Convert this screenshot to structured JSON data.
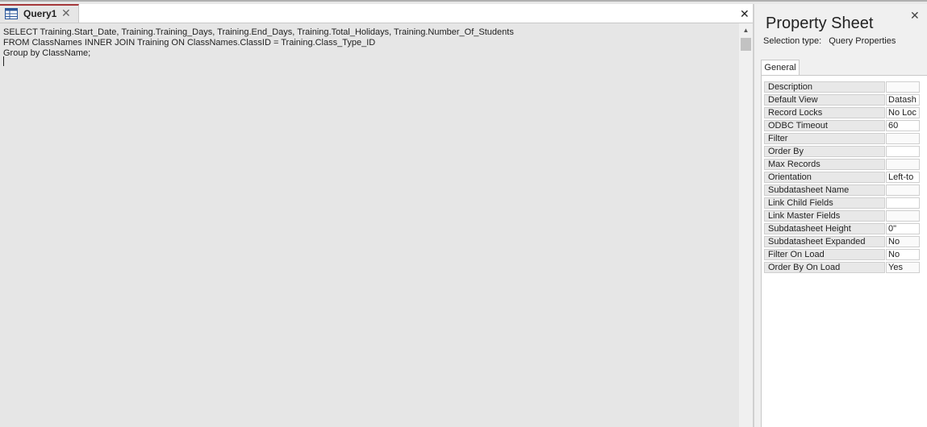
{
  "document": {
    "tab_label": "Query1",
    "sql_lines": [
      "SELECT Training.Start_Date, Training.Training_Days, Training.End_Days, Training.Total_Holidays, Training.Number_Of_Students",
      "FROM ClassNames INNER JOIN Training ON ClassNames.ClassID = Training.Class_Type_ID",
      "Group by ClassName;"
    ]
  },
  "property_sheet": {
    "title": "Property Sheet",
    "selection_type_label": "Selection type:",
    "selection_type_value": "Query Properties",
    "active_tab": "General",
    "properties": [
      {
        "name": "Description",
        "value": ""
      },
      {
        "name": "Default View",
        "value": "Datash"
      },
      {
        "name": "Record Locks",
        "value": "No Loc"
      },
      {
        "name": "ODBC Timeout",
        "value": "60"
      },
      {
        "name": "Filter",
        "value": ""
      },
      {
        "name": "Order By",
        "value": ""
      },
      {
        "name": "Max Records",
        "value": ""
      },
      {
        "name": "Orientation",
        "value": "Left-to"
      },
      {
        "name": "Subdatasheet Name",
        "value": ""
      },
      {
        "name": "Link Child Fields",
        "value": ""
      },
      {
        "name": "Link Master Fields",
        "value": ""
      },
      {
        "name": "Subdatasheet Height",
        "value": "0\""
      },
      {
        "name": "Subdatasheet Expanded",
        "value": "No"
      },
      {
        "name": "Filter On Load",
        "value": "No"
      },
      {
        "name": "Order By On Load",
        "value": "Yes"
      }
    ]
  },
  "icons": {
    "query_tab_icon": "query-table-icon",
    "tab_close_icon": "close-icon",
    "doc_close_icon": "close-icon",
    "sheet_close_icon": "close-icon",
    "scroll_up_icon": "scroll-up-arrow-icon"
  },
  "colors": {
    "tab_accent": "#a4373a",
    "editor_background": "#e6e6e6",
    "sheet_background": "#f0f0f0"
  }
}
